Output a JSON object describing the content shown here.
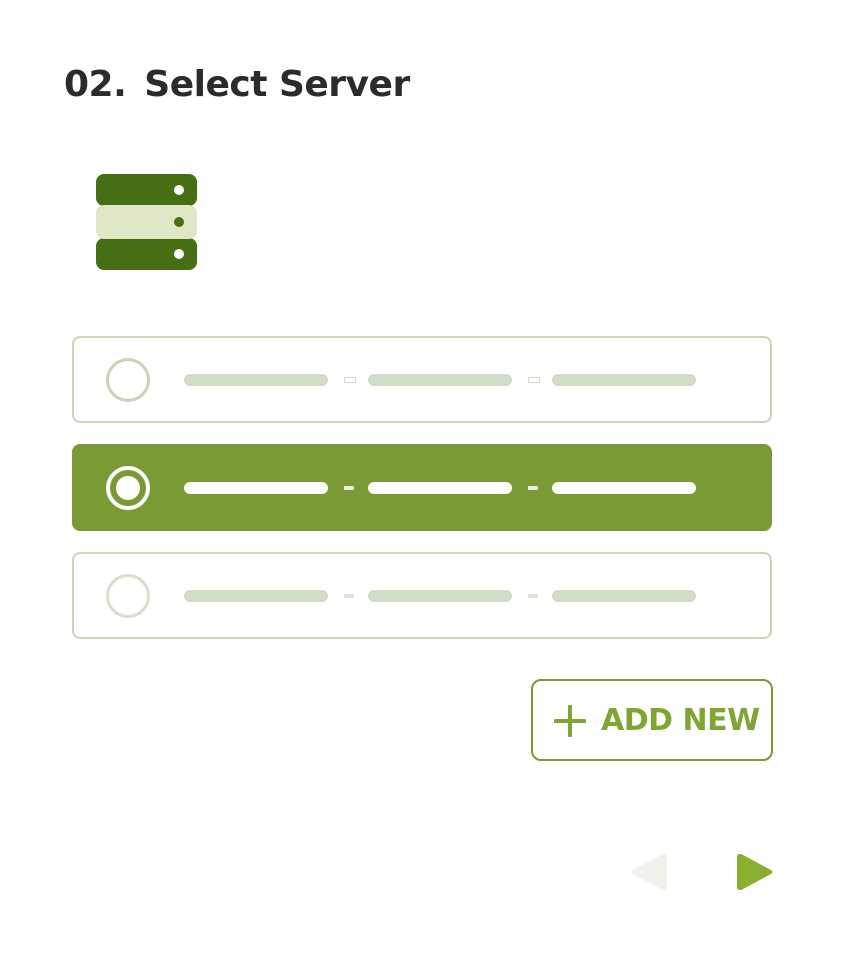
{
  "header": {
    "step_number": "02.",
    "title": "Select Server"
  },
  "icons": {
    "server": "server-icon",
    "radio_unselected": "radio-unselected-icon",
    "radio_selected": "radio-selected-icon",
    "plus": "plus-icon",
    "prev": "arrow-left-icon",
    "next": "arrow-right-icon"
  },
  "server_options": [
    {
      "selected": false
    },
    {
      "selected": true
    },
    {
      "selected": false
    }
  ],
  "actions": {
    "add_new_label": "ADD NEW"
  },
  "colors": {
    "accent": "#7a9a35",
    "accent_text": "#7fa634",
    "server_dark": "#456f12",
    "server_light": "#dfe7c6",
    "placeholder": "#d2dcc7",
    "border": "#cfd4b8",
    "prev_disabled": "#eef2ea",
    "next": "#86b02d",
    "title": "#2b2b2b"
  },
  "navigation": {
    "prev_enabled": false,
    "next_enabled": true
  }
}
